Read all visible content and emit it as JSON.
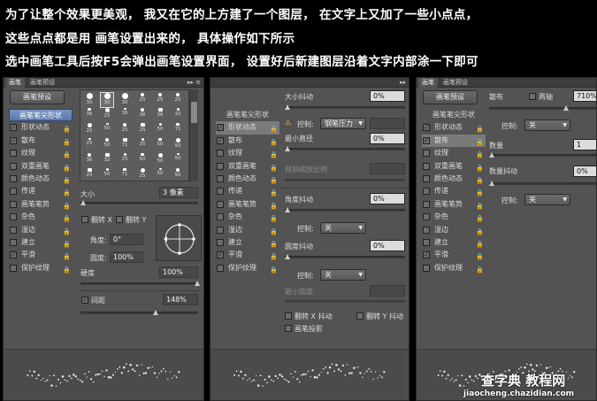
{
  "caption": {
    "line1": "为了让整个效果更美观， 我又在它的上方建了一个图层， 在文字上又加了一些小点点，",
    "line2": "这些点点都是用 画笔设置出来的， 具体操作如下所示",
    "line3": "选中画笔工具后按F5会弹出画笔设置界面， 设置好后新建图层沿着文字内部涂一下即可"
  },
  "tabs": {
    "brush": "画笔",
    "brush_presets": "画笔预设",
    "menu_glyph": "▸▸ ≡",
    "menu_glyph_short": "▸▸"
  },
  "preset_button": "画笔预设",
  "options": [
    {
      "label": "画笔笔尖形状"
    },
    {
      "label": "形状动态",
      "checked": "✓"
    },
    {
      "label": "散布",
      "checked": "✓"
    },
    {
      "label": "纹理",
      "checked": ""
    },
    {
      "label": "双重画笔",
      "checked": ""
    },
    {
      "label": "颜色动态",
      "checked": ""
    },
    {
      "label": "传递",
      "checked": ""
    },
    {
      "label": "画笔笔势",
      "checked": ""
    },
    {
      "label": "杂色",
      "checked": ""
    },
    {
      "label": "湿边",
      "checked": ""
    },
    {
      "label": "建立",
      "checked": ""
    },
    {
      "label": "平滑",
      "checked": "✓"
    },
    {
      "label": "保护纹理",
      "checked": ""
    }
  ],
  "lock_glyph": "🔒",
  "check_glyph": "✓",
  "brush_tips": {
    "rows": [
      [
        "30",
        "30",
        "30",
        "25",
        "25",
        "25"
      ],
      [
        "36",
        "25",
        "36",
        "36",
        "36",
        "32"
      ],
      [
        "25",
        "50",
        "25",
        "25",
        "50",
        "71"
      ],
      [
        "25",
        "50",
        "71",
        "25",
        "50",
        "50"
      ],
      [
        "36",
        "32",
        "25",
        "50",
        "50",
        "50"
      ],
      [
        "25",
        "50",
        "71",
        "25",
        "50",
        "50"
      ]
    ]
  },
  "panel1": {
    "size_label": "大小",
    "size_value": "3 像素",
    "flip_x": "翻转 X",
    "flip_y": "翻转 Y",
    "angle_label": "角度:",
    "angle_value": "0°",
    "roundness_label": "圆度:",
    "roundness_value": "100%",
    "hardness_label": "硬度",
    "hardness_value": "100%",
    "spacing_label": "间距",
    "spacing_value": "148%"
  },
  "panel2": {
    "size_jitter_label": "大小抖动",
    "size_jitter_value": "0%",
    "control_label": "控制:",
    "control_pen": "钢笔压力",
    "warning_glyph": "⚠",
    "min_diameter_label": "最小直径",
    "min_diameter_value": "0%",
    "tilt_scale_label": "倾斜缩放比例",
    "angle_jitter_label": "角度抖动",
    "angle_jitter_value": "0%",
    "control_off": "关",
    "roundness_jitter_label": "圆度抖动",
    "roundness_jitter_value": "0%",
    "min_roundness_label": "最小圆度",
    "flip_x_jitter": "翻转 X 抖动",
    "flip_y_jitter": "翻转 Y 抖动",
    "brush_projection": "画笔投影"
  },
  "panel3": {
    "scatter_label": "散布",
    "both_axes_label": "两轴",
    "scatter_value": "710%",
    "control_label": "控制:",
    "control_off": "关",
    "count_label": "数量",
    "count_value": "1",
    "count_jitter_label": "数量抖动",
    "count_jitter_value": "0%"
  },
  "watermark": {
    "main": "查字典 教程网",
    "sub": "jiaocheng.chazidian.com"
  }
}
